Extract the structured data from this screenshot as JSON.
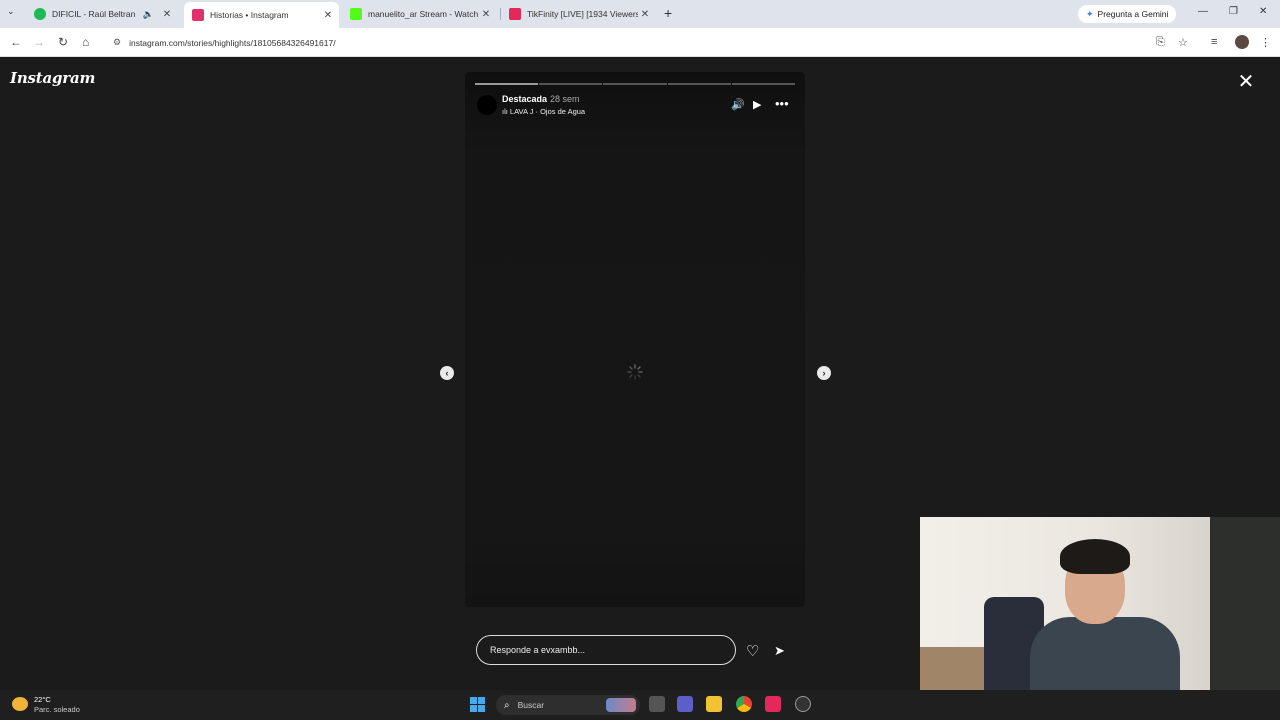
{
  "browser": {
    "tabs": [
      {
        "title": "DIFICIL - Raúl Beltran",
        "favicon_color": "#1db954",
        "audio": true,
        "active": false
      },
      {
        "title": "Historias • Instagram",
        "favicon_color": "#e1306c",
        "active": true
      },
      {
        "title": "manuelito_ar Stream - Watch Li",
        "favicon_color": "#53fc18",
        "active": false
      },
      {
        "title": "TikFinity [LIVE] [1934 Viewers]",
        "favicon_color": "#e5285a",
        "active": false
      }
    ],
    "gemini_label": "Pregunta a Gemini",
    "url": "instagram.com/stories/highlights/18105684326491617/"
  },
  "instagram": {
    "logo": "Instagram",
    "story": {
      "username": "Destacada",
      "time": "28 sem",
      "song": "LAVA J · Ojos de Agua",
      "segments": 5,
      "active_segment": 0
    },
    "reply_placeholder": "Responde a evxambb..."
  },
  "taskbar": {
    "temperature": "22°C",
    "weather": "Parc. soleado",
    "search_label": "Buscar"
  },
  "colors": {
    "page_bg": "#1b1b1b",
    "story_bg": "#151515",
    "tabstrip_bg": "#dfe3eb",
    "taskbar_bg": "#1f1f1f"
  }
}
